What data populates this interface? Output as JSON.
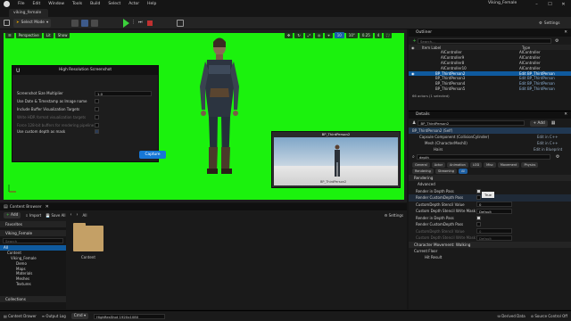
{
  "title_bar": {
    "menu": [
      "File",
      "Edit",
      "Window",
      "Tools",
      "Build",
      "Select",
      "Actor",
      "Help"
    ],
    "project_name": "Viking_Female"
  },
  "level_tab": "viking_female",
  "toolbar": {
    "mode": "Select Mode",
    "settings": "Settings"
  },
  "viewport": {
    "perspective": "Perspective",
    "lit": "Lit",
    "show": "Show",
    "snap_value": "10",
    "rotation_value": "10°",
    "scale_value": "0.25",
    "camera_speed": "4",
    "bg_color": "#1bf20d"
  },
  "screenshot_dialog": {
    "title": "High Resolution Screenshot",
    "size_multiplier_label": "Screenshot Size Multiplier",
    "size_multiplier_value": "1.0",
    "opt_date": "Use Date & Timestamp as Image name",
    "opt_buffer": "Include Buffer Visualization Targets",
    "opt_hdr": "Write HDR format visualization targets",
    "opt_ue4": "Force 128-bit buffers for rendering pipeline",
    "opt_custom": "Use custom depth as mask",
    "capture": "Capture"
  },
  "pip": {
    "title": "BP_ThirdPerson2",
    "label": "BP_ThirdPerson2"
  },
  "outliner": {
    "title": "Outliner",
    "search_placeholder": "Search...",
    "col_label": "Item Label",
    "col_type": "Type",
    "rows": [
      {
        "label": "AIController",
        "type": "AIController"
      },
      {
        "label": "AIController9",
        "type": "AIController"
      },
      {
        "label": "AIController8",
        "type": "AIController"
      },
      {
        "label": "AIController10",
        "type": "AIController"
      },
      {
        "label": "BP_ThirdPerson2",
        "type": "Edit BP_ThirdPerson"
      },
      {
        "label": "BP_ThirdPerson3",
        "type": "Edit BP_ThirdPerson"
      },
      {
        "label": "BP_ThirdPerson4",
        "type": "Edit BP_ThirdPerson"
      },
      {
        "label": "BP_ThirdPerson5",
        "type": "Edit BP_ThirdPerson"
      }
    ],
    "selected_index": 4,
    "footer": "66 actors (1 selected)"
  },
  "details": {
    "title": "Details",
    "actor_name": "BP_ThirdPerson2",
    "add": "+ Add",
    "self_row": "BP_ThirdPerson2 (Self)",
    "capsule": "Capsule Component (CollisionCylinder)",
    "capsule_edit": "Edit in C++",
    "mesh": "Mesh (CharacterMesh0)",
    "mesh_edit": "Edit in C++",
    "hairs": "Hairs",
    "hairs_edit": "Edit in Blueprint",
    "search_value": "depth",
    "filter_tabs": [
      "General",
      "Actor",
      "Animation",
      "LOD",
      "Misc",
      "Movement",
      "Physics"
    ],
    "filter_tabs2": [
      "Rendering",
      "Streaming",
      "All"
    ],
    "rendering_header": "Rendering",
    "advanced": "Advanced",
    "props": [
      "Render in Depth Pass",
      "Render CustomDepth Pass",
      "CustomDepth Stencil Value",
      "Custom Depth Stencil Write Mask",
      "Render in Depth Pass",
      "Render CustomDepth Pass",
      "CustomDepth Stencil Value",
      "Custom Depth Stencil Write Mask"
    ],
    "stencil_value_1": "0",
    "stencil_value_2": "0",
    "write_mask_1": "Default",
    "write_mask_2": "Default",
    "tooltip": "True",
    "movement_header": "Character Movement: Walking",
    "current_floor": "Current Floor",
    "hit_result": "Hit Result"
  },
  "content_browser": {
    "title": "Content Browser",
    "add": "Add",
    "import": "Import",
    "save_all": "Save All",
    "path_all": "All",
    "settings": "Settings",
    "favorites": "Favorites",
    "project": "Viking_Female",
    "search_placeholder": "Search",
    "tree": [
      "All",
      "Content",
      "Viking_Female",
      "Demo",
      "Maps",
      "Materials",
      "Meshes",
      "Textures"
    ],
    "folder_label": "Content",
    "collections": "Collections"
  },
  "status_bar": {
    "content_drawer": "Content Drawer",
    "output_log": "Output Log",
    "cmd": "Cmd",
    "cmd_value": "HighResShot 1920x1080",
    "derived_data": "Derived Data",
    "source_control": "Source Control Off"
  }
}
